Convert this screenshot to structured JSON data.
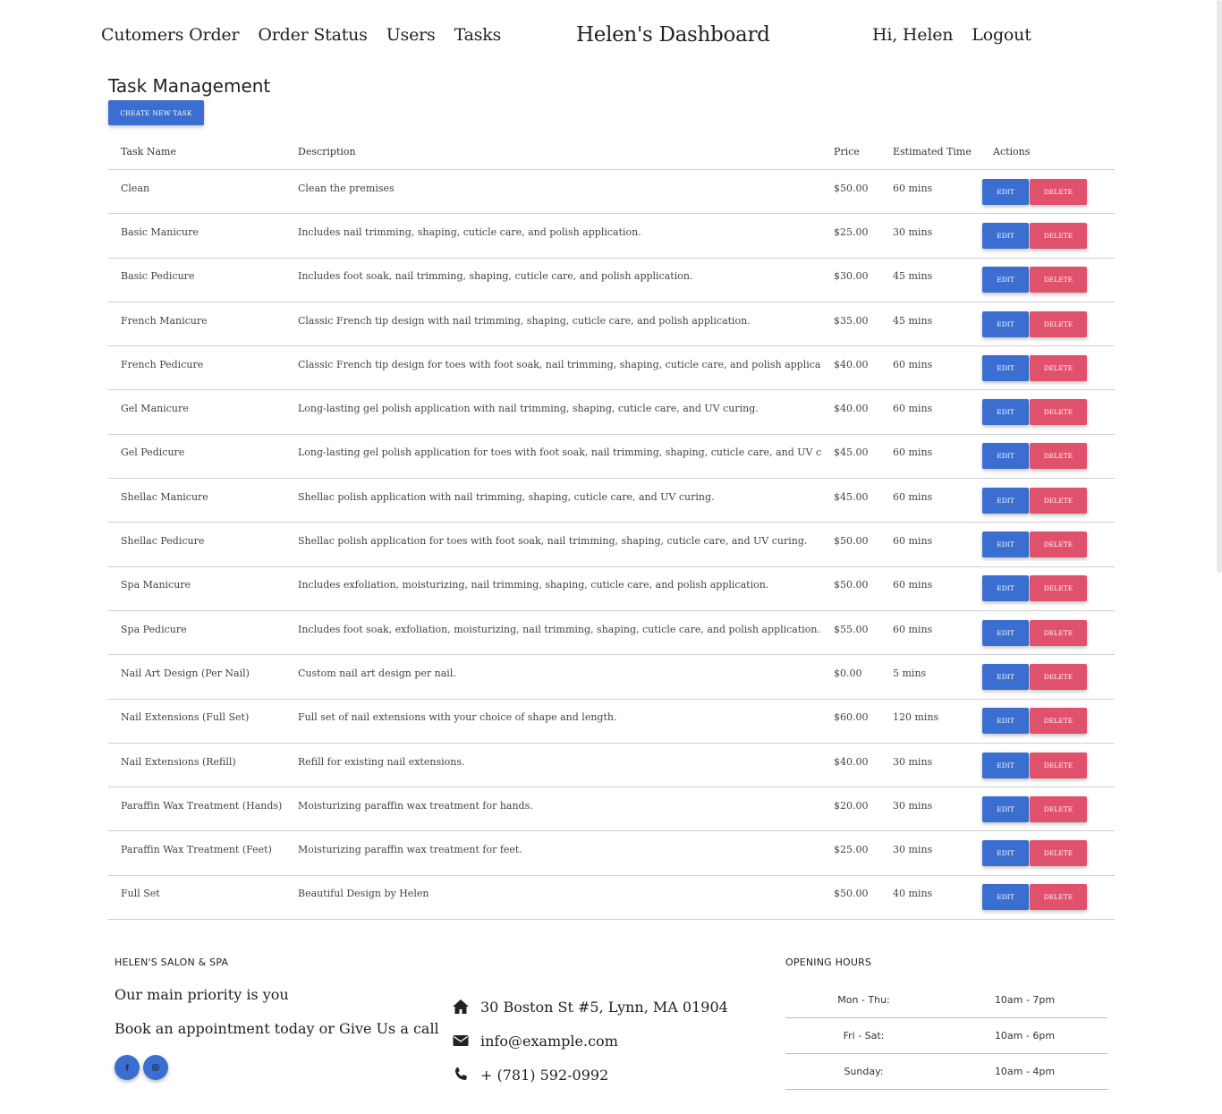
{
  "nav": {
    "links": [
      "Cutomers Order",
      "Order Status",
      "Users",
      "Tasks"
    ],
    "brand": "Helen's Dashboard",
    "greeting": "Hi, Helen",
    "logout": "Logout"
  },
  "main": {
    "title": "Task Management",
    "create_button": "CREATE NEW TASK",
    "columns": [
      "Task Name",
      "Description",
      "Price",
      "Estimated Time",
      "Actions"
    ],
    "edit_label": "EDIT",
    "delete_label": "DELETE",
    "tasks": [
      {
        "name": "Clean",
        "description": "Clean the premises",
        "price": "$50.00",
        "time": "60 mins"
      },
      {
        "name": "Basic Manicure",
        "description": "Includes nail trimming, shaping, cuticle care, and polish application.",
        "price": "$25.00",
        "time": "30 mins"
      },
      {
        "name": "Basic Pedicure",
        "description": "Includes foot soak, nail trimming, shaping, cuticle care, and polish application.",
        "price": "$30.00",
        "time": "45 mins"
      },
      {
        "name": "French Manicure",
        "description": "Classic French tip design with nail trimming, shaping, cuticle care, and polish application.",
        "price": "$35.00",
        "time": "45 mins"
      },
      {
        "name": "French Pedicure",
        "description": "Classic French tip design for toes with foot soak, nail trimming, shaping, cuticle care, and polish application.",
        "price": "$40.00",
        "time": "60 mins"
      },
      {
        "name": "Gel Manicure",
        "description": "Long-lasting gel polish application with nail trimming, shaping, cuticle care, and UV curing.",
        "price": "$40.00",
        "time": "60 mins"
      },
      {
        "name": "Gel Pedicure",
        "description": "Long-lasting gel polish application for toes with foot soak, nail trimming, shaping, cuticle care, and UV curing.",
        "price": "$45.00",
        "time": "60 mins"
      },
      {
        "name": "Shellac Manicure",
        "description": "Shellac polish application with nail trimming, shaping, cuticle care, and UV curing.",
        "price": "$45.00",
        "time": "60 mins"
      },
      {
        "name": "Shellac Pedicure",
        "description": "Shellac polish application for toes with foot soak, nail trimming, shaping, cuticle care, and UV curing.",
        "price": "$50.00",
        "time": "60 mins"
      },
      {
        "name": "Spa Manicure",
        "description": "Includes exfoliation, moisturizing, nail trimming, shaping, cuticle care, and polish application.",
        "price": "$50.00",
        "time": "60 mins"
      },
      {
        "name": "Spa Pedicure",
        "description": "Includes foot soak, exfoliation, moisturizing, nail trimming, shaping, cuticle care, and polish application.",
        "price": "$55.00",
        "time": "60 mins"
      },
      {
        "name": "Nail Art Design (Per Nail)",
        "description": "Custom nail art design per nail.",
        "price": "$0.00",
        "time": "5 mins"
      },
      {
        "name": "Nail Extensions (Full Set)",
        "description": "Full set of nail extensions with your choice of shape and length.",
        "price": "$60.00",
        "time": "120 mins"
      },
      {
        "name": "Nail Extensions (Refill)",
        "description": "Refill for existing nail extensions.",
        "price": "$40.00",
        "time": "30 mins"
      },
      {
        "name": "Paraffin Wax Treatment (Hands)",
        "description": "Moisturizing paraffin wax treatment for hands.",
        "price": "$20.00",
        "time": "30 mins"
      },
      {
        "name": "Paraffin Wax Treatment (Feet)",
        "description": "Moisturizing paraffin wax treatment for feet.",
        "price": "$25.00",
        "time": "30 mins"
      },
      {
        "name": "Full Set",
        "description": "Beautiful Design by Helen",
        "price": "$50.00",
        "time": "40 mins"
      }
    ]
  },
  "footer": {
    "about_heading": "HELEN'S SALON & SPA",
    "tagline": "Our main priority is you",
    "cta": "Book an appointment today or Give Us a call",
    "social_icons": [
      "facebook-icon",
      "instagram-icon"
    ],
    "address": "30 Boston St #5, Lynn, MA 01904",
    "email": "info@example.com",
    "phone": "+ (781) 592-0992",
    "hours_heading": "OPENING HOURS",
    "hours": [
      {
        "day": "Mon - Thu:",
        "time": "10am - 7pm"
      },
      {
        "day": "Fri - Sat:",
        "time": "10am - 6pm"
      },
      {
        "day": "Sunday:",
        "time": "10am - 4pm"
      }
    ]
  },
  "colors": {
    "primary": "#3a6fd1",
    "danger": "#e0516c",
    "text": "#222222"
  }
}
